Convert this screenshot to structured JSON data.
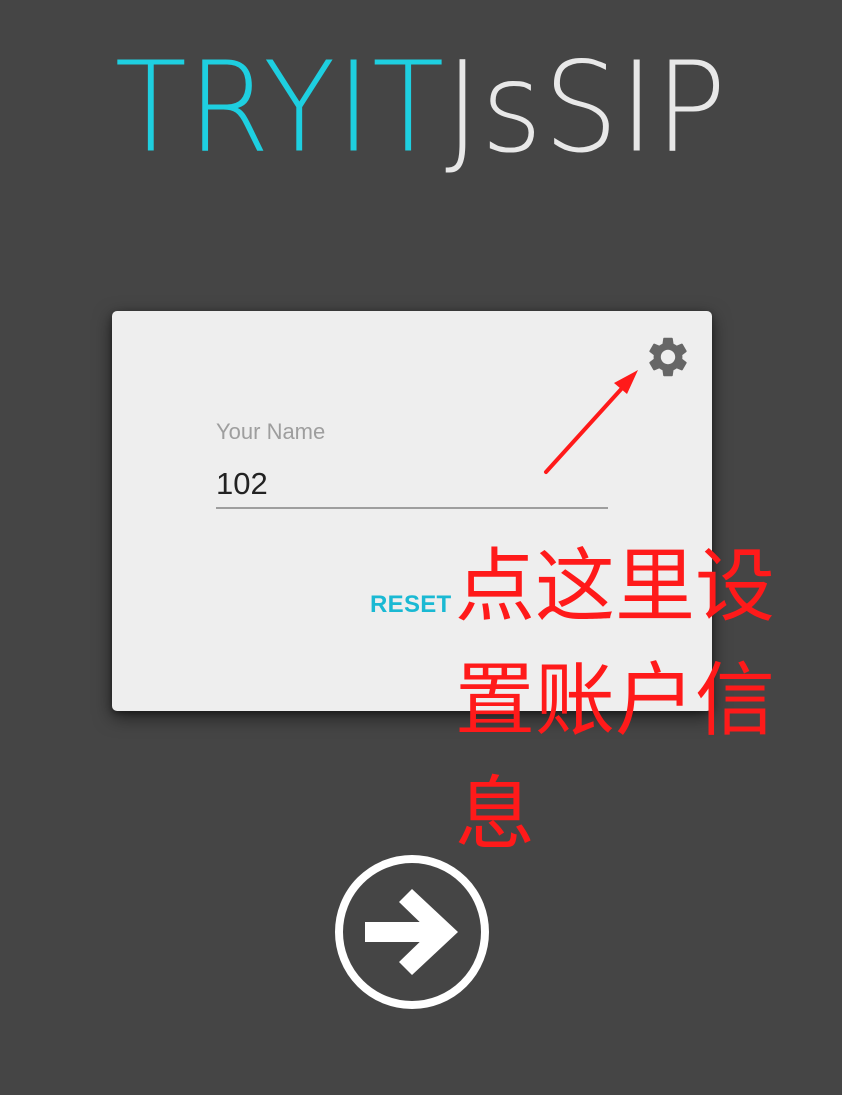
{
  "logo": {
    "part1": "TRYIT",
    "part2": "JsSIP"
  },
  "login": {
    "name_label": "Your Name",
    "name_value": "102",
    "reset_label": "RESET",
    "settings_icon": "gear-icon"
  },
  "annotation": {
    "text": "点这里设置账户信息",
    "color": "#ff1a1a"
  },
  "go": {
    "icon": "arrow-right-icon"
  },
  "colors": {
    "background": "#454545",
    "accent": "#1ecfe0",
    "card": "#eeeeee",
    "reset": "#1ab9d3"
  }
}
